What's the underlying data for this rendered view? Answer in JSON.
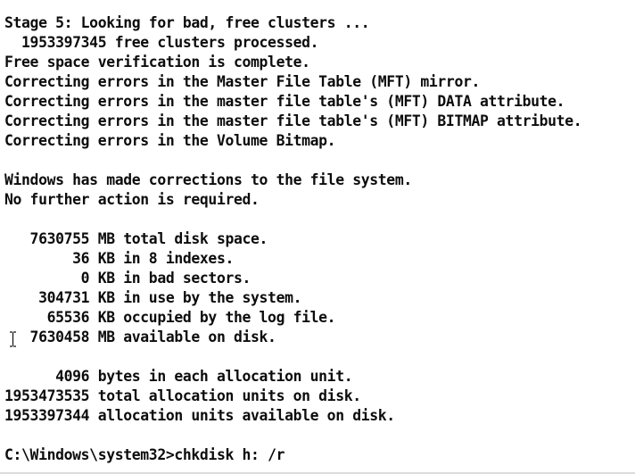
{
  "console": {
    "lines": [
      "Stage 5: Looking for bad, free clusters ...",
      "  1953397345 free clusters processed.",
      "Free space verification is complete.",
      "Correcting errors in the Master File Table (MFT) mirror.",
      "Correcting errors in the master file table's (MFT) DATA attribute.",
      "Correcting errors in the master file table's (MFT) BITMAP attribute.",
      "Correcting errors in the Volume Bitmap.",
      "",
      "Windows has made corrections to the file system.",
      "No further action is required.",
      "",
      "   7630755 MB total disk space.",
      "        36 KB in 8 indexes.",
      "         0 KB in bad sectors.",
      "    304731 KB in use by the system.",
      "     65536 KB occupied by the log file.",
      "   7630458 MB available on disk.",
      "",
      "      4096 bytes in each allocation unit.",
      "1953473535 total allocation units on disk.",
      "1953397344 allocation units available on disk.",
      "",
      "C:\\Windows\\system32>chkdisk h: /r"
    ]
  },
  "prompt": {
    "path": "C:\\Windows\\system32>",
    "command": "chkdisk h: /r"
  },
  "pointer": {
    "icon": "text-cursor-ibeam-icon"
  },
  "colors": {
    "background": "#ffffff",
    "text": "#0c0c0c"
  }
}
